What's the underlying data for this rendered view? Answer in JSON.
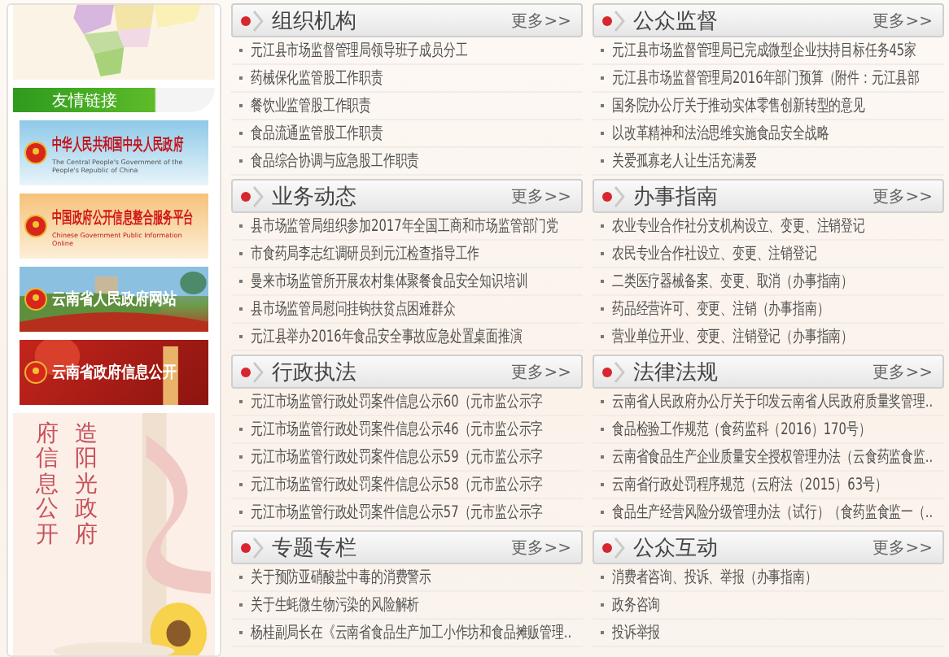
{
  "sidebar": {
    "links_header": "友情链接",
    "links": [
      {
        "kind": "sky",
        "title": "中华人民共和国中央人民政府",
        "subtitle": "The Central People's Government of the People's Republic of China"
      },
      {
        "kind": "cream",
        "title": "中国政府公开信息整合服务平台",
        "subtitle": "Chinese Government Public Information Online"
      },
      {
        "kind": "landscape",
        "title": "云南省人民政府网站"
      },
      {
        "kind": "red",
        "title": "云南省政府信息公开"
      }
    ],
    "poster": {
      "kind": "picture",
      "columns": [
        "府信息公开",
        "造阳光政府"
      ]
    }
  },
  "panels": [
    {
      "title": "组织机构",
      "more": "更多>>",
      "items": [
        "元江县市场监督管理局领导班子成员分工",
        "药械保化监管股工作职责",
        "餐饮业监管股工作职责",
        "食品流通监管股工作职责",
        "食品综合协调与应急股工作职责"
      ]
    },
    {
      "title": "公众监督",
      "more": "更多>>",
      "items": [
        "元江县市场监督管理局已完成微型企业扶持目标任务45家",
        "元江县市场监督管理局2016年部门预算（附件：元江县部",
        "国务院办公厅关于推动实体零售创新转型的意见",
        "以改革精神和法治思维实施食品安全战略",
        "关爱孤寡老人让生活充满爱"
      ]
    },
    {
      "title": "业务动态",
      "more": "更多>>",
      "items": [
        "县市场监管局组织参加2017年全国工商和市场监管部门党",
        "市食药局李志红调研员到元江检查指导工作",
        "曼来市场监管所开展农村集体聚餐食品安全知识培训",
        "县市场监管局慰问挂钩扶贫点困难群众",
        "元江县举办2016年食品安全事故应急处置桌面推演"
      ]
    },
    {
      "title": "办事指南",
      "more": "更多>>",
      "items": [
        "农业专业合作社分支机构设立、变更、注销登记",
        "农民专业合作社设立、变更、注销登记",
        "二类医疗器械备案、变更、取消（办事指南）",
        "药品经营许可、变更、注销（办事指南）",
        "营业单位开业、变更、注销登记（办事指南）"
      ]
    },
    {
      "title": "行政执法",
      "more": "更多>>",
      "items": [
        "元江市场监管行政处罚案件信息公示60（元市监公示字",
        "元江市场监管行政处罚案件信息公示46（元市监公示字",
        "元江市场监管行政处罚案件信息公示59（元市监公示字",
        "元江市场监管行政处罚案件信息公示58（元市监公示字",
        "元江市场监管行政处罚案件信息公示57（元市监公示字"
      ]
    },
    {
      "title": "法律法规",
      "more": "更多>>",
      "items": [
        "云南省人民政府办公厅关于印发云南省人民政府质量奖管理..",
        "食品检验工作规范（食药监科（2016）170号）",
        "云南省食品生产企业质量安全授权管理办法（云食药监食监..",
        "云南省行政处罚程序规范（云府法（2015）63号）",
        "食品生产经营风险分级管理办法（试行）（食药监食监一（.."
      ]
    },
    {
      "title": "专题专栏",
      "more": "更多>>",
      "items": [
        "关于预防亚硝酸盐中毒的消费警示",
        "关于生蚝微生物污染的风险解析",
        "杨桂副局长在《云南省食品生产加工小作坊和食品摊贩管理.."
      ]
    },
    {
      "title": "公众互动",
      "more": "更多>>",
      "items": [
        "消费者咨询、投诉、举报（办事指南）",
        "政务咨询",
        "投诉举报"
      ]
    }
  ]
}
